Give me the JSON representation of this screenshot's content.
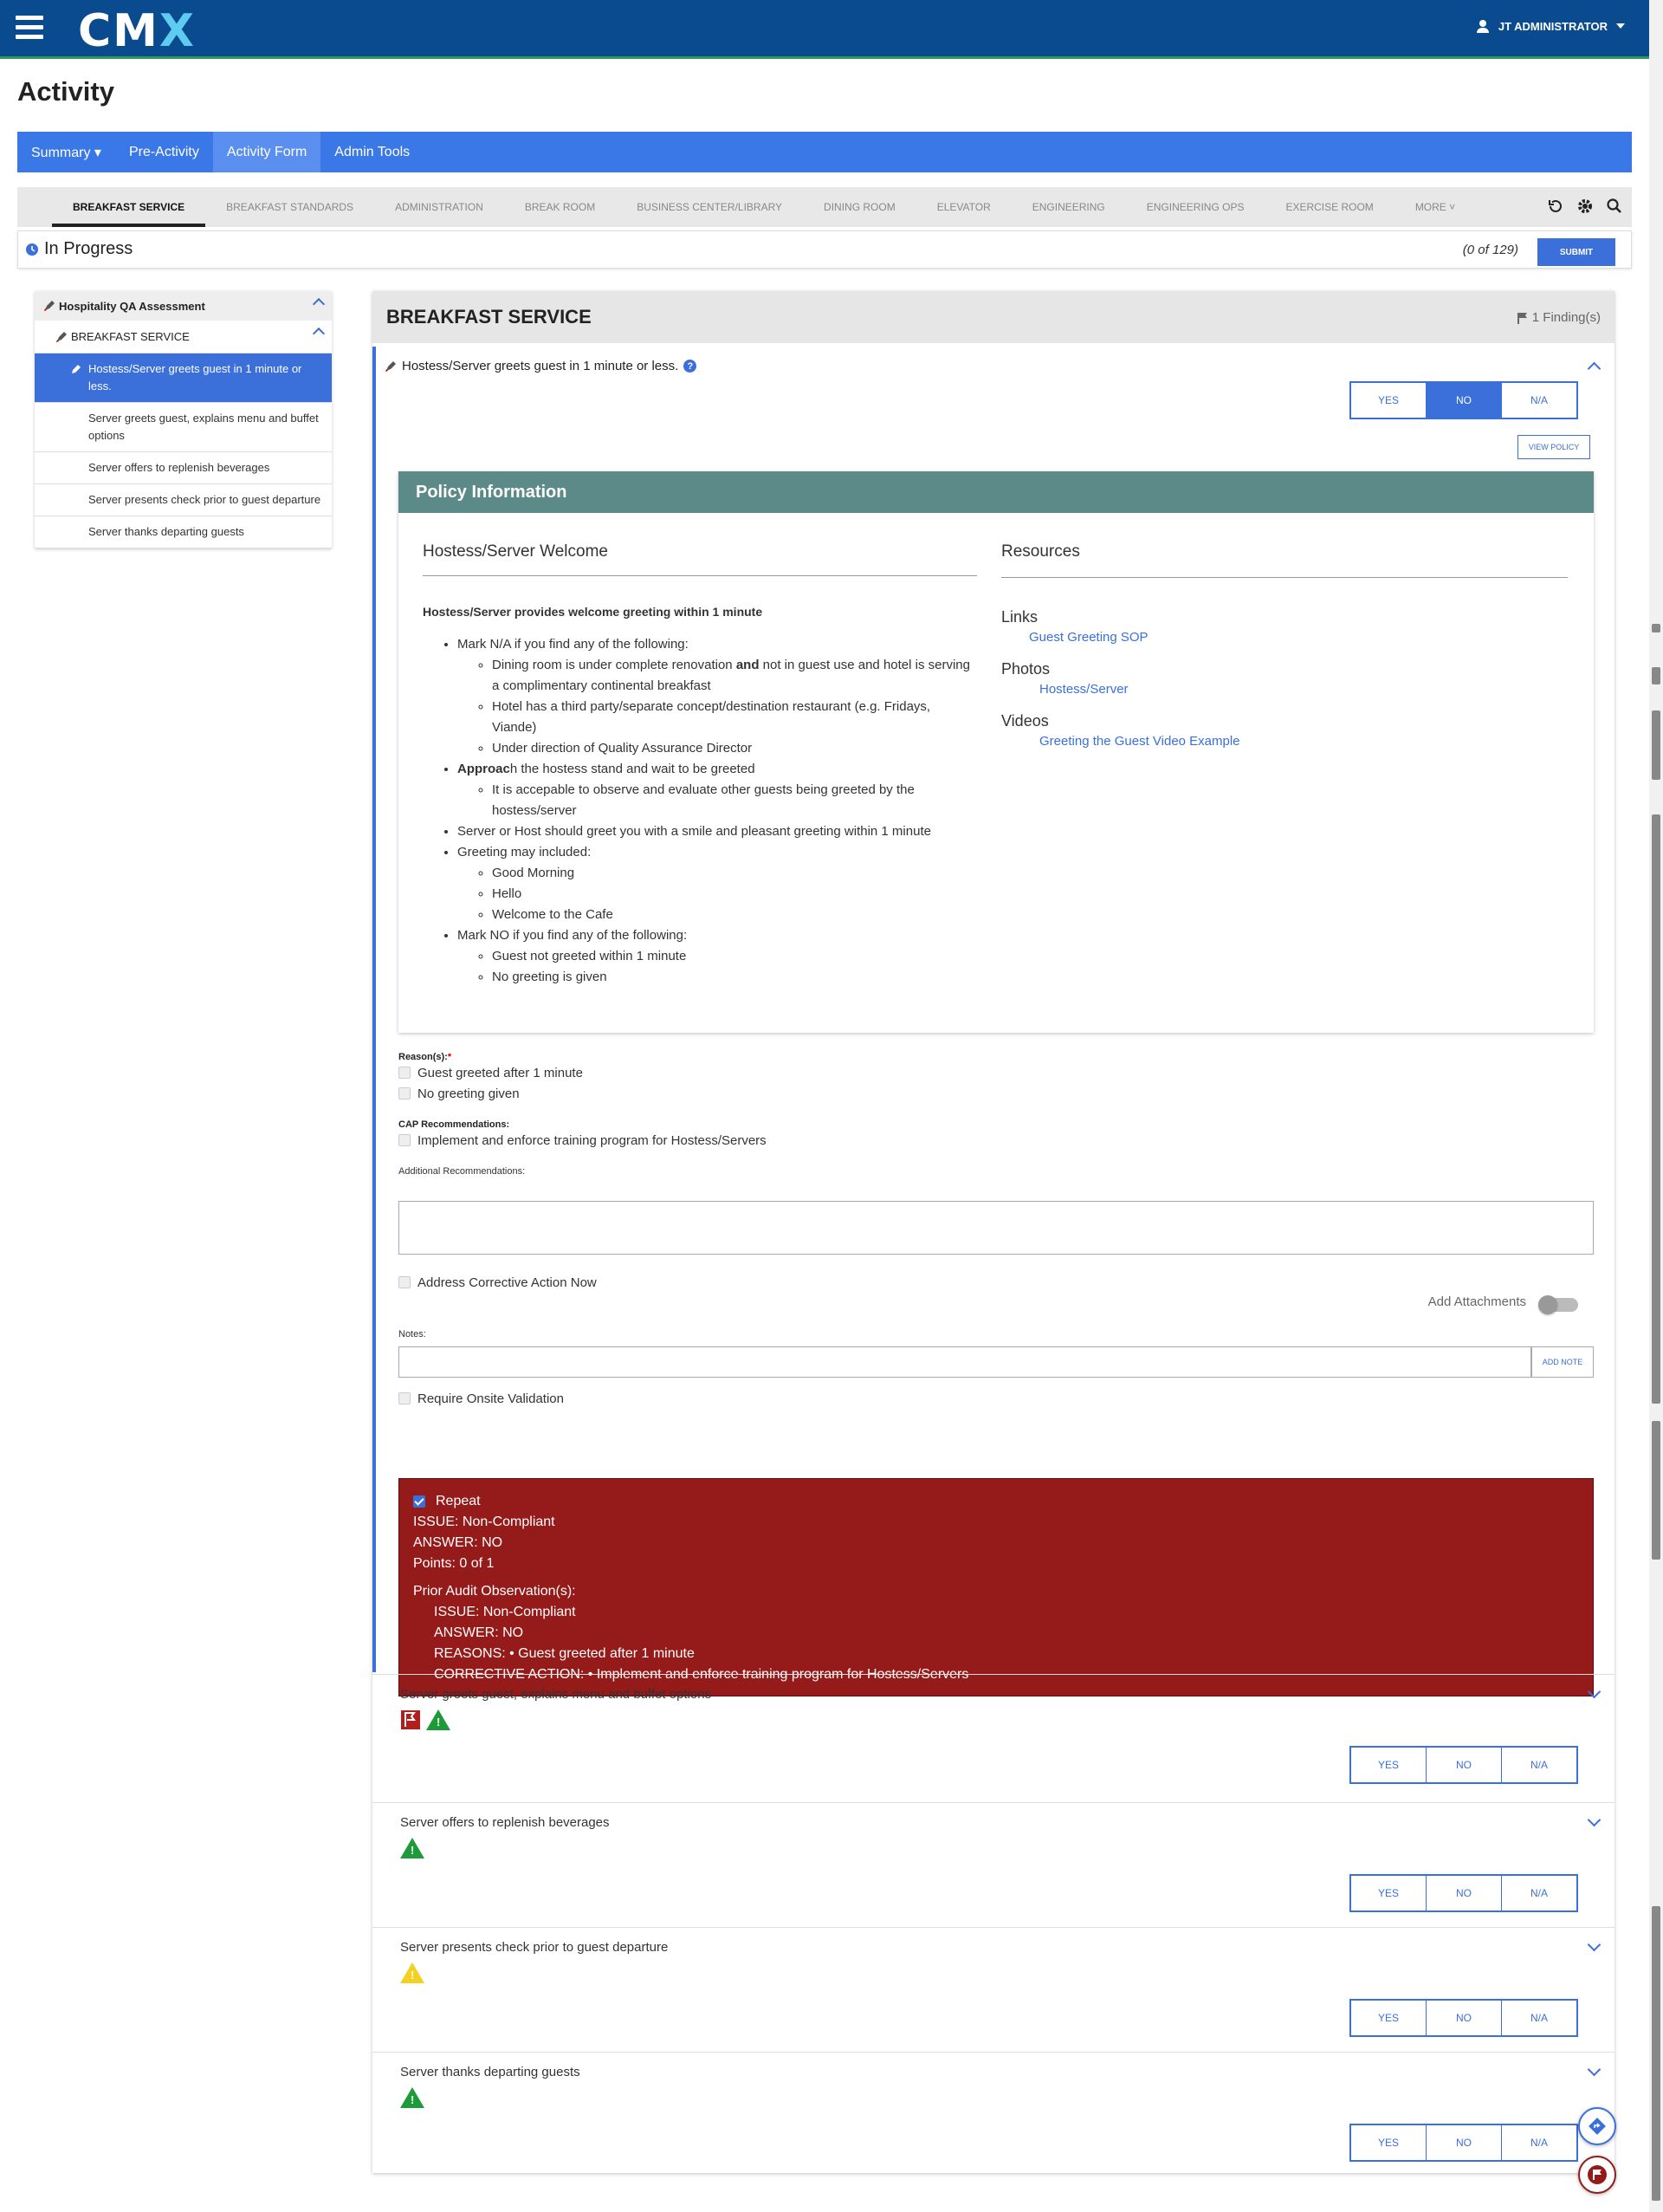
{
  "header": {
    "logo": "CMX",
    "user": "JT ADMINISTRATOR"
  },
  "page_title": "Activity",
  "nav": {
    "items": [
      {
        "label": "Summary ▾"
      },
      {
        "label": "Pre-Activity"
      },
      {
        "label": "Activity Form"
      },
      {
        "label": "Admin Tools"
      }
    ]
  },
  "tabs": [
    "BREAKFAST SERVICE",
    "BREAKFAST STANDARDS",
    "ADMINISTRATION",
    "BREAK ROOM",
    "BUSINESS CENTER/LIBRARY",
    "DINING ROOM",
    "ELEVATOR",
    "ENGINEERING",
    "ENGINEERING OPS",
    "EXERCISE ROOM",
    "MORE ˅"
  ],
  "status": {
    "label": "In Progress",
    "count": "(0 of 129)",
    "submit": "SUBMIT"
  },
  "sidebar": {
    "assessment": "Hospitality QA Assessment",
    "section": "BREAKFAST SERVICE",
    "items": [
      "Hostess/Server greets guest in 1 minute or less.",
      "Server greets guest, explains menu and buffet options",
      "Server offers to replenish beverages",
      "Server presents check prior to guest departure",
      "Server thanks departing guests"
    ]
  },
  "main": {
    "title": "BREAKFAST SERVICE",
    "findings": "1 Finding(s)",
    "q1": {
      "title": "Hostess/Server greets guest in 1 minute or less.",
      "answers": [
        "YES",
        "NO",
        "N/A"
      ],
      "selected": "NO",
      "view_policy": "VIEW POLICY"
    },
    "policy": {
      "header": "Policy Information",
      "left_title": "Hostess/Server Welcome",
      "right_title": "Resources",
      "heading": "Hostess/Server provides welcome greeting within 1 minute",
      "mark_na": "Mark N/A if you find any of the following:",
      "na_1a": "Dining room is under complete renovation ",
      "na_1b": "and",
      "na_1c": " not in guest use and hotel is serving a complimentary continental breakfast",
      "na_2": "Hotel has a third party/separate concept/destination restaurant (e.g. Fridays, Viande)",
      "na_3": "Under direction of Quality Assurance Director",
      "approach_bold": "Approac",
      "approach_rest": "h the hostess stand and wait to be greeted",
      "approach_sub": "It is accepable to observe and evaluate other guests being greeted by the hostess/server",
      "server_host": "Server or Host should greet you with a smile and pleasant greeting within 1 minute",
      "greeting_included": "Greeting may included:",
      "greet_1": "Good Morning",
      "greet_2": "Hello",
      "greet_3": "Welcome to the Cafe",
      "mark_no": "Mark NO if you find any of the following:",
      "no_1": "Guest not greeted within 1 minute",
      "no_2": "No greeting is given",
      "links_h": "Links",
      "link_1": "Guest Greeting SOP",
      "photos_h": "Photos",
      "photo_1": "Hostess/Server",
      "videos_h": "Videos",
      "video_1": "Greeting the Guest Video Example"
    },
    "reasons_label": "Reason(s):",
    "reasons": [
      "Guest greeted after 1 minute",
      "No greeting given"
    ],
    "cap_label": "CAP Recommendations:",
    "cap": [
      "Implement and enforce training program for Hostess/Servers"
    ],
    "additional_label": "Additional Recommendations:",
    "address_now": "Address Corrective Action Now",
    "add_attachments": "Add Attachments",
    "notes_label": "Notes:",
    "add_note": "ADD NOTE",
    "require_onsite": "Require Onsite Validation",
    "repeat": {
      "label": "Repeat",
      "issue": "ISSUE: Non-Compliant",
      "answer": "ANSWER: NO",
      "points": "Points: 0 of 1",
      "prior": "Prior Audit Observation(s):",
      "p_issue": "ISSUE: Non-Compliant",
      "p_answer": "ANSWER: NO",
      "p_reasons": "REASONS: • Guest greeted after 1 minute",
      "p_ca": "CORRECTIVE ACTION: • Implement and enforce training program for Hostess/Servers"
    },
    "questions": [
      {
        "title": "Server greets guest, explains menu and buffet options"
      },
      {
        "title": "Server offers to replenish beverages"
      },
      {
        "title": "Server presents check prior to guest departure"
      },
      {
        "title": "Server thanks departing guests"
      }
    ],
    "yes": "YES",
    "no": "NO",
    "na": "N/A"
  },
  "colors": {
    "brand": "#0a4b8f",
    "accent": "#3b6fd9",
    "repeat_bg": "#951a1a",
    "policy_head": "#5b8a88"
  }
}
